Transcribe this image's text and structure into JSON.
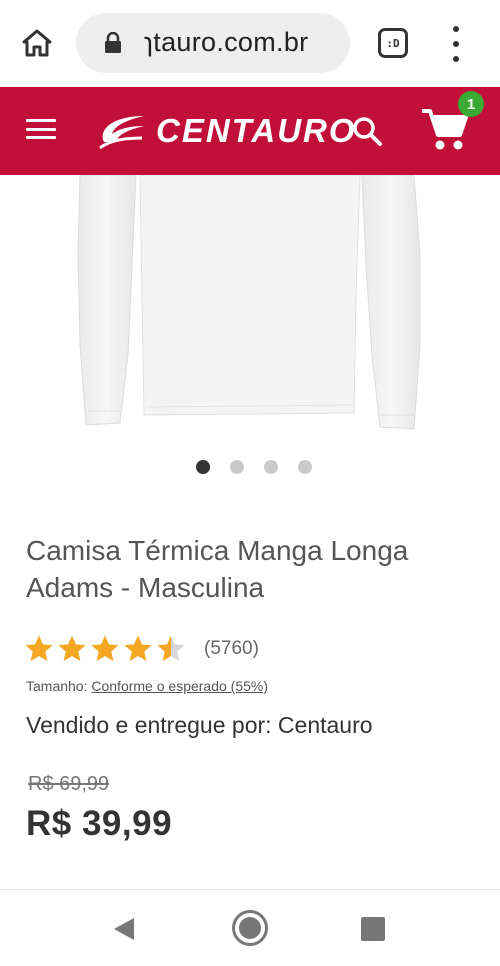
{
  "browser": {
    "url": "ɿtauro.com.br",
    "tab_label": ":D"
  },
  "header": {
    "brand": "CENTAURO",
    "cart_count": "1",
    "colors": {
      "header_bg": "#c0103a",
      "badge_bg": "#3aaa35"
    }
  },
  "product": {
    "title": "Camisa Térmica Manga Longa Adams - Masculina",
    "rating": 4.5,
    "review_count": "(5760)",
    "size_label": "Tamanho:",
    "size_value": "Conforme o esperado (55%)",
    "seller": "Vendido e entregue por: Centauro",
    "old_price": "R$ 69,99",
    "price": "R$ 39,99"
  },
  "carousel": {
    "total": 4,
    "active_index": 0
  },
  "icons": {
    "home": "home-icon",
    "lock": "lock-icon",
    "tabs": "tabs-icon",
    "menu": "more-vert-icon",
    "hamburger": "hamburger-menu-icon",
    "search": "search-icon",
    "cart": "shopping-cart-icon",
    "star": "star-icon",
    "back": "back-icon",
    "recents": "recents-icon"
  }
}
